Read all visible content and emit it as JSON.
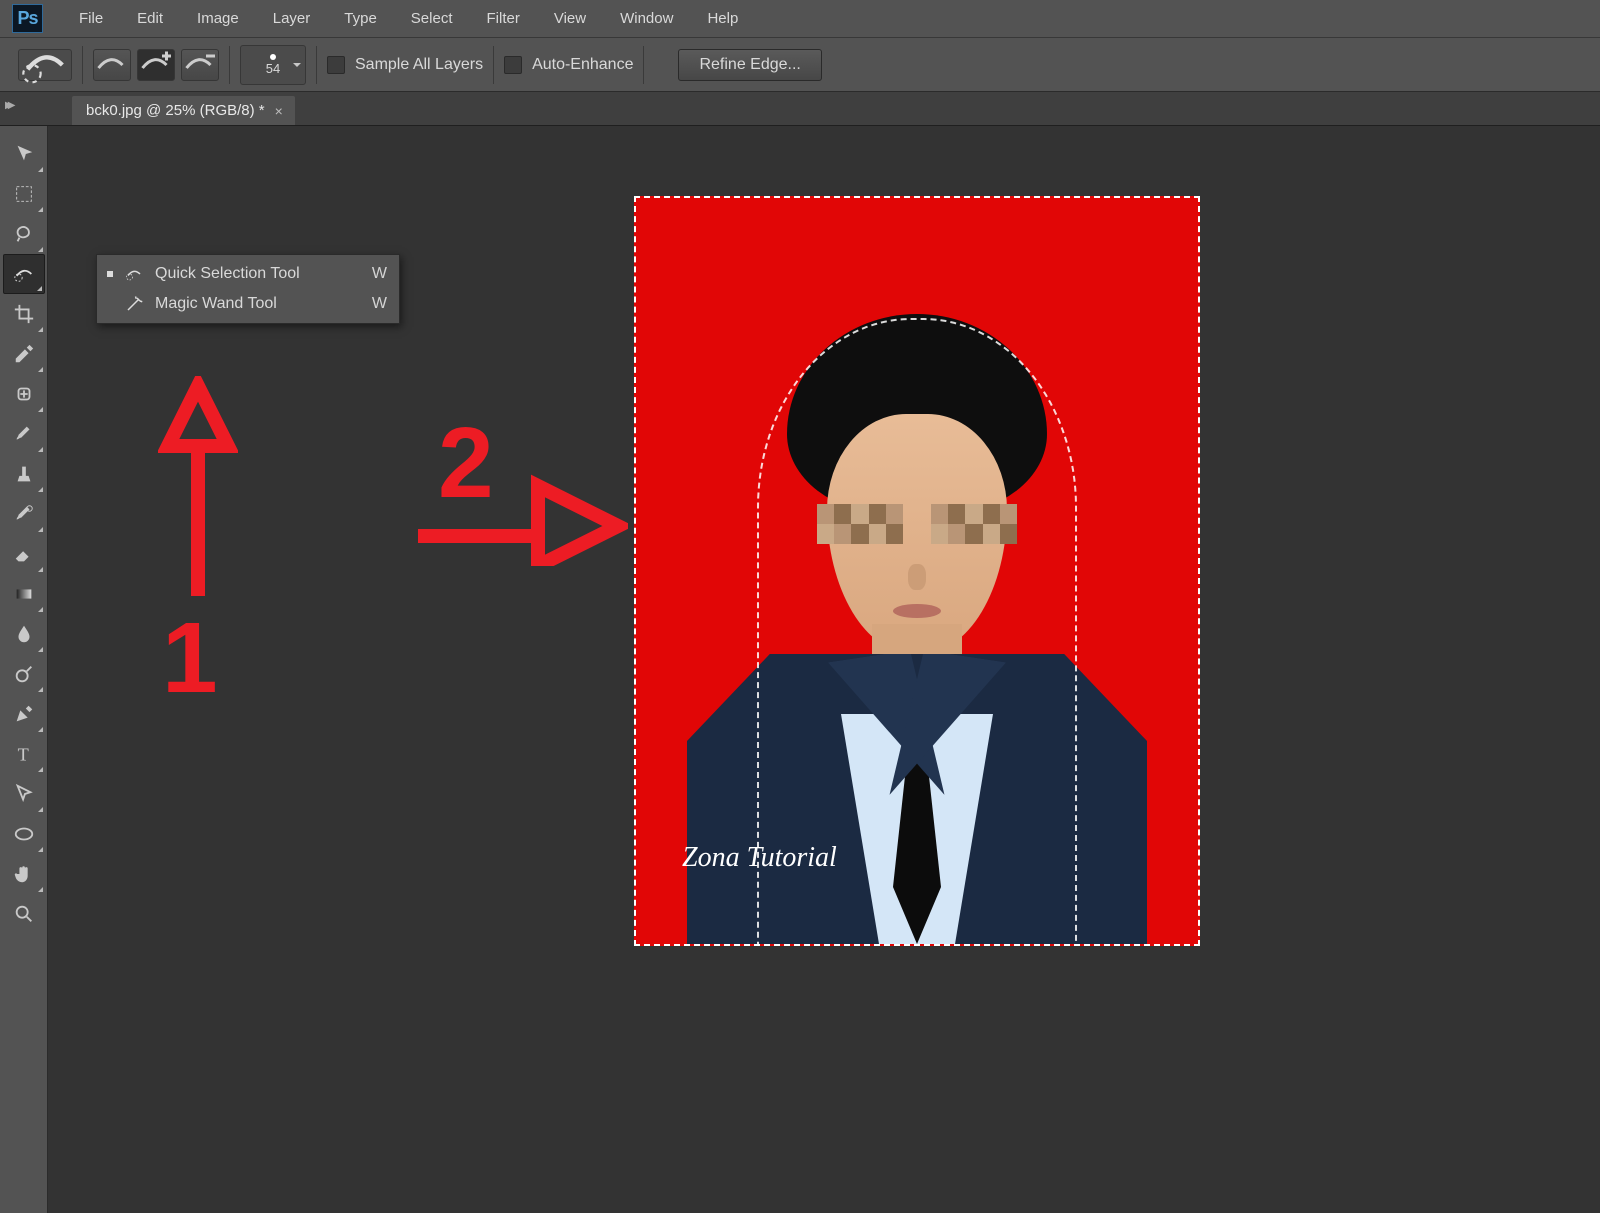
{
  "app": {
    "logo_text": "Ps"
  },
  "menu": {
    "items": [
      "File",
      "Edit",
      "Image",
      "Layer",
      "Type",
      "Select",
      "Filter",
      "View",
      "Window",
      "Help"
    ]
  },
  "options": {
    "brush_size": "54",
    "sample_all_layers": "Sample All Layers",
    "auto_enhance": "Auto-Enhance",
    "refine_edge": "Refine Edge..."
  },
  "tab": {
    "title": "bck0.jpg @ 25% (RGB/8) *",
    "close": "×"
  },
  "tools": {
    "names": [
      "move",
      "marquee",
      "lasso",
      "quick-selection",
      "crop",
      "eyedropper",
      "healing",
      "brush",
      "stamp",
      "history-brush",
      "eraser",
      "gradient",
      "blur",
      "dodge",
      "pen",
      "type",
      "path-select",
      "shape",
      "hand",
      "zoom"
    ]
  },
  "flyout": {
    "items": [
      {
        "label": "Quick Selection Tool",
        "key": "W",
        "icon": "quick-selection-icon",
        "selected": true
      },
      {
        "label": "Magic Wand Tool",
        "key": "W",
        "icon": "magic-wand-icon",
        "selected": false
      }
    ]
  },
  "annotations": {
    "label1": "1",
    "label2": "2"
  },
  "canvas": {
    "watermark": "Zona Tutorial"
  }
}
